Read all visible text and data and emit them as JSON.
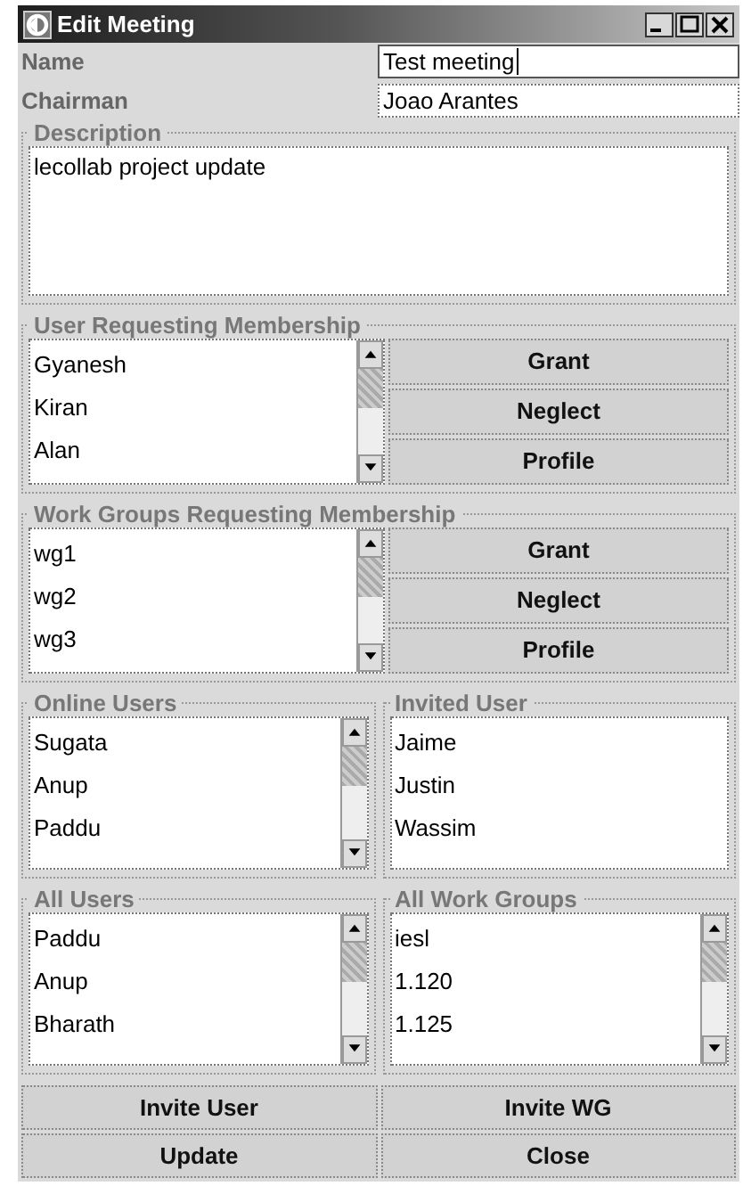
{
  "window": {
    "title": "Edit Meeting"
  },
  "fields": [
    {
      "label": "Name",
      "value": "Test meeting",
      "focused": true
    },
    {
      "label": "Chairman",
      "value": "Joao Arantes",
      "focused": false
    }
  ],
  "description": {
    "title": "Description",
    "value": "lecollab project update"
  },
  "request_groups": [
    {
      "title": "User Requesting Membership",
      "items": [
        "Gyanesh",
        "Kiran",
        "Alan"
      ],
      "buttons": [
        "Grant",
        "Neglect",
        "Profile"
      ]
    },
    {
      "title": "Work Groups Requesting Membership",
      "items": [
        "wg1",
        "wg2",
        "wg3"
      ],
      "buttons": [
        "Grant",
        "Neglect",
        "Profile"
      ]
    }
  ],
  "list_rows": [
    [
      {
        "title": "Online Users",
        "items": [
          "Sugata",
          "Anup",
          "Paddu"
        ],
        "scrollbar": true
      },
      {
        "title": "Invited User",
        "items": [
          "Jaime",
          "Justin",
          "Wassim"
        ],
        "scrollbar": false
      }
    ],
    [
      {
        "title": "All Users",
        "items": [
          "Paddu",
          "Anup",
          "Bharath"
        ],
        "scrollbar": true
      },
      {
        "title": "All Work Groups",
        "items": [
          "iesl",
          "1.120",
          "1.125"
        ],
        "scrollbar": true
      }
    ]
  ],
  "buttons": [
    "Invite User",
    "Invite WG",
    "Update",
    "Close"
  ]
}
